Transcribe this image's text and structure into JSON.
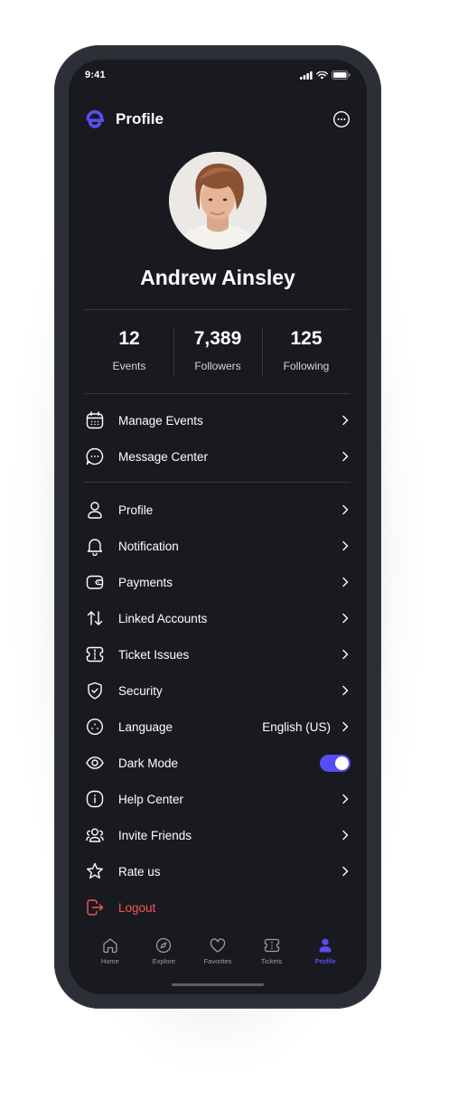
{
  "status_bar": {
    "time": "9:41"
  },
  "header": {
    "title": "Profile"
  },
  "user": {
    "name": "Andrew Ainsley"
  },
  "stats": [
    {
      "value": "12",
      "label": "Events"
    },
    {
      "value": "7,389",
      "label": "Followers"
    },
    {
      "value": "125",
      "label": "Following"
    }
  ],
  "menu_primary": [
    {
      "label": "Manage Events",
      "icon": "calendar-icon"
    },
    {
      "label": "Message Center",
      "icon": "chat-icon"
    }
  ],
  "menu_settings": [
    {
      "label": "Profile",
      "icon": "user-icon"
    },
    {
      "label": "Notification",
      "icon": "bell-icon"
    },
    {
      "label": "Payments",
      "icon": "wallet-icon"
    },
    {
      "label": "Linked Accounts",
      "icon": "swap-icon"
    },
    {
      "label": "Ticket Issues",
      "icon": "ticket-icon"
    },
    {
      "label": "Security",
      "icon": "shield-icon"
    },
    {
      "label": "Language",
      "icon": "globe-icon",
      "value": "English (US)"
    },
    {
      "label": "Dark Mode",
      "icon": "eye-icon",
      "toggle": true
    },
    {
      "label": "Help Center",
      "icon": "info-icon"
    },
    {
      "label": "Invite Friends",
      "icon": "people-icon"
    },
    {
      "label": "Rate us",
      "icon": "star-icon"
    },
    {
      "label": "Logout",
      "icon": "logout-icon"
    }
  ],
  "bottom_nav": [
    {
      "label": "Home",
      "icon": "home-icon",
      "active": false
    },
    {
      "label": "Explore",
      "icon": "compass-icon",
      "active": false
    },
    {
      "label": "Favorites",
      "icon": "heart-icon",
      "active": false
    },
    {
      "label": "Tickets",
      "icon": "ticket-icon",
      "active": false
    },
    {
      "label": "Profile",
      "icon": "profile-icon",
      "active": true
    }
  ],
  "colors": {
    "background": "#181a20",
    "accent": "#584cf4",
    "danger": "#f75555",
    "divider": "#35383f"
  }
}
